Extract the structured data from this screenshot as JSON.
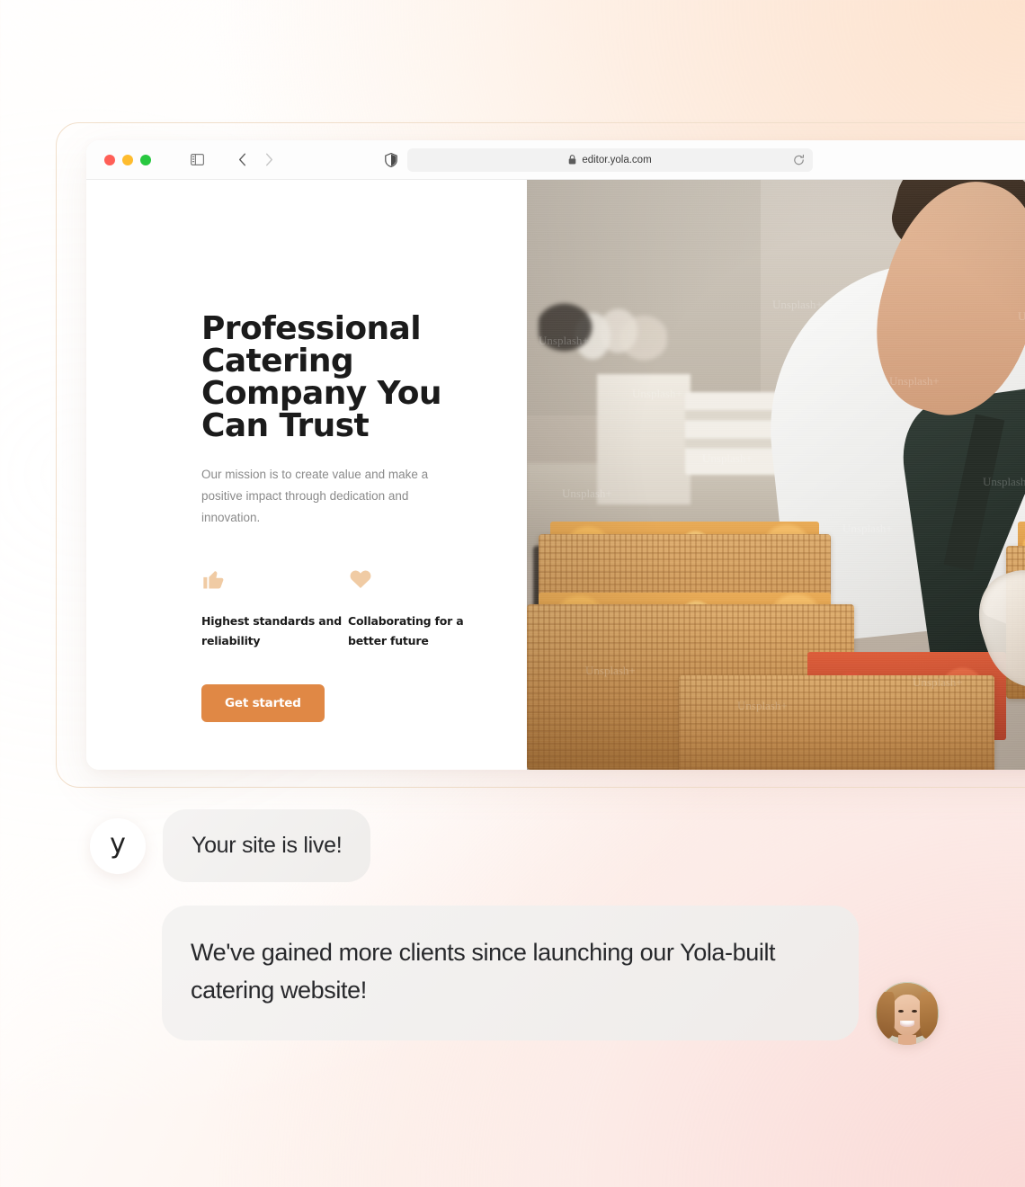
{
  "browser": {
    "url": "editor.yola.com",
    "lock_icon": "lock-icon",
    "reload_icon": "reload-icon",
    "sidebar_icon": "sidebar-toggle-icon",
    "back_icon": "chevron-left-icon",
    "forward_icon": "chevron-right-icon",
    "shield_icon": "shield-privacy-icon",
    "traffic_lights": [
      "close-red",
      "minimize-yellow",
      "maximize-green"
    ]
  },
  "site": {
    "hero": {
      "title": "Professional Catering Company You Can Trust",
      "subtitle": "Our mission is to create value and make a positive impact through dedication and innovation.",
      "cta_label": "Get started",
      "cta_color": "#e08845",
      "icon_color": "#f0cba4"
    },
    "features": [
      {
        "icon": "thumbs-up-icon",
        "label": "Highest standards and reliability"
      },
      {
        "icon": "heart-icon",
        "label": "Collaborating for a better future"
      }
    ],
    "photo": {
      "alt": "Caterer in white shirt and dark apron arranging pastries in wicker baskets",
      "watermarks": [
        "Unsplash+",
        "Unsplash+",
        "Unsplash+",
        "Unsplash+",
        "Unsplash+",
        "Unsplash+",
        "Unsplash+",
        "Unsplash+",
        "Unsplash+",
        "Unsplash+",
        "Unsplash+",
        "Unsplash+"
      ]
    }
  },
  "chat": {
    "brand_initial": "y",
    "messages": [
      {
        "text": "Your site is live!"
      },
      {
        "text": "We've gained more clients since launching our Yola-built catering website!"
      }
    ],
    "client_avatar": "client-photo-avatar"
  }
}
